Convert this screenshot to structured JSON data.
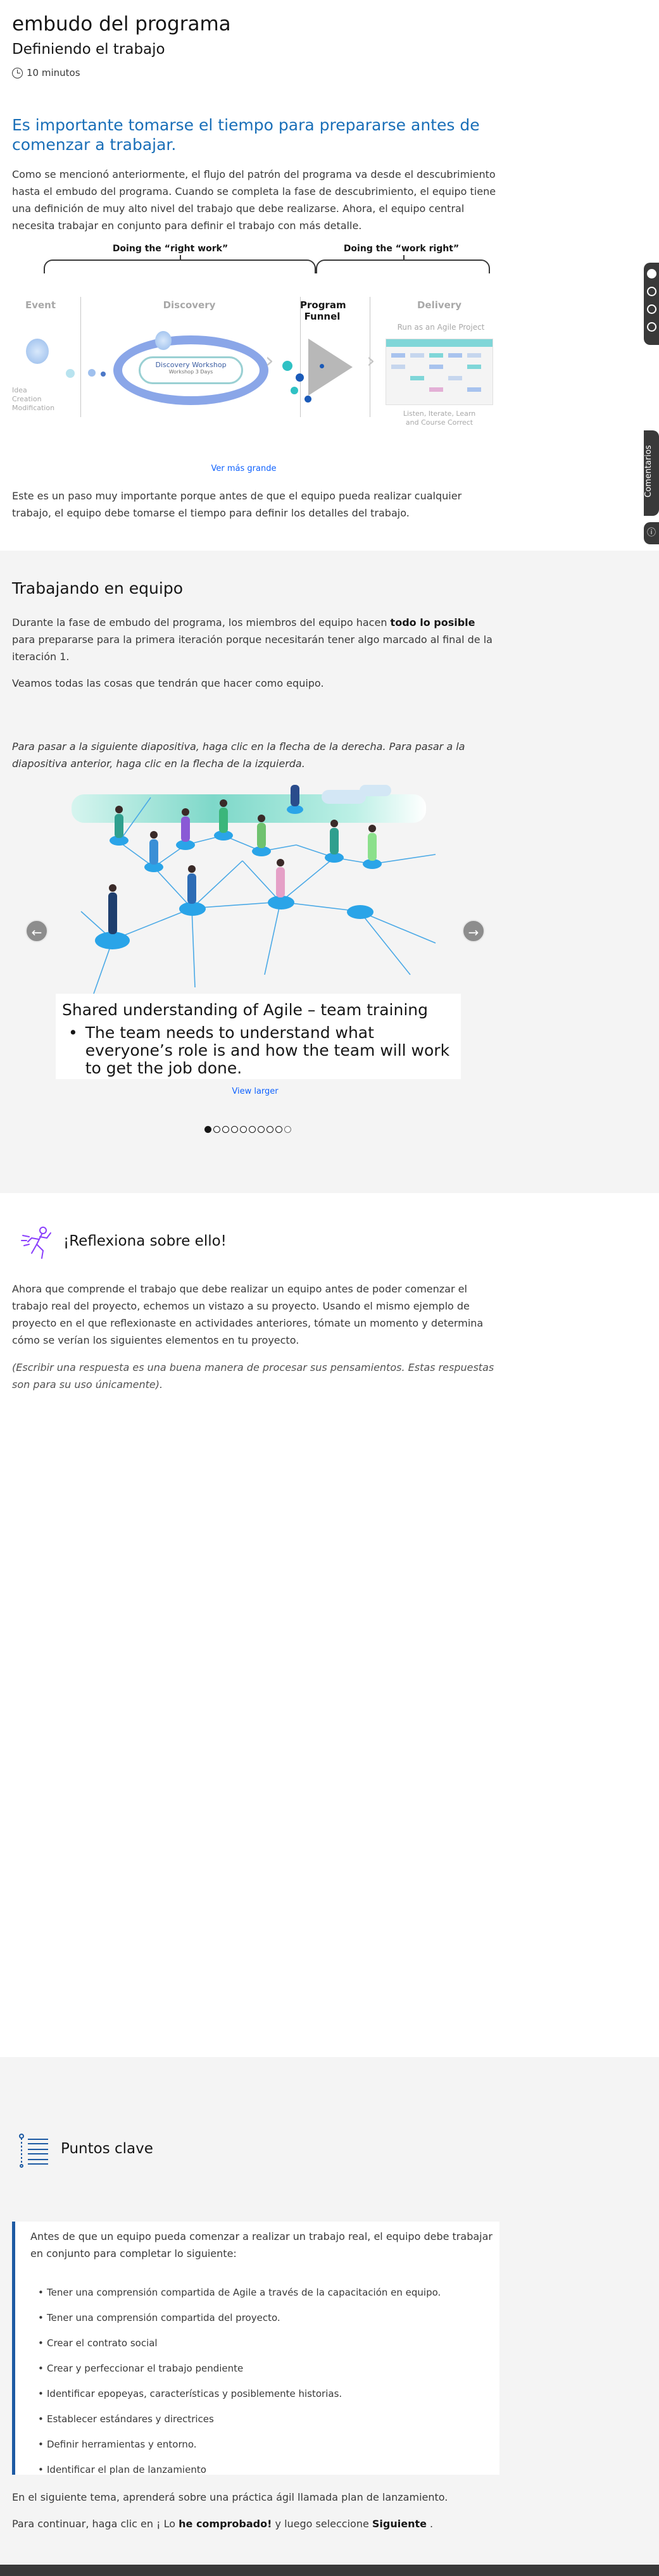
{
  "header": {
    "title": "embudo del programa",
    "subtitle": "Definiendo el trabajo",
    "duration": "10 minutos"
  },
  "section1": {
    "heading": "Es importante tomarse el tiempo para prepararse antes de comenzar a trabajar.",
    "p1": "Como se mencionó anteriormente, el flujo del patrón del programa va desde el descubrimiento hasta el embudo del programa. Cuando se completa la fase de descubrimiento, el equipo tiene una definición de muy alto nivel del trabajo que debe realizarse. Ahora, el equipo central necesita trabajar en conjunto para definir el trabajo con más detalle.",
    "view_larger": "Ver más grande",
    "p2": "Este es un paso muy importante porque antes de que el equipo pueda realizar cualquier trabajo, el equipo debe tomarse el tiempo para definir los detalles del trabajo."
  },
  "diagram": {
    "group_left": "Doing the “right work”",
    "group_right": "Doing the “work right”",
    "col_event": "Event",
    "col_discovery": "Discovery",
    "col_funnel": "Program Funnel",
    "col_delivery": "Delivery",
    "idea_text": "Idea\nCreation\nModification",
    "workshop_title": "Discovery Workshop",
    "workshop_sub": "Workshop 3 Days",
    "run_label": "Run as an Agile Project",
    "delivery_text": "Listen, Iterate, Learn\nand Course Correct"
  },
  "section2": {
    "heading": "Trabajando en equipo",
    "p1_before": "Durante la fase de embudo del programa, los miembros del equipo hacen ",
    "p1_bold": "todo lo posible",
    "p1_after": " para prepararse para la primera iteración porque necesitarán tener algo marcado al final de la iteración 1.",
    "p2": "Veamos todas las cosas que tendrán que hacer como equipo.",
    "instructions": "Para pasar a la siguiente diapositiva, haga clic en la flecha de la derecha. Para pasar a la diapositiva anterior, haga clic en la flecha de la izquierda."
  },
  "carousel": {
    "caption_title": "Shared understanding of Agile – team training",
    "caption_bullet": "The team needs to understand what everyone’s role is and how the team will work to get the job done.",
    "view_larger": "View larger",
    "slide_count": 10,
    "current_slide": 1
  },
  "section3": {
    "heading": "¡Reflexiona sobre ello!",
    "p1": "Ahora que comprende el trabajo que debe realizar un equipo antes de poder comenzar el trabajo real del proyecto, echemos un vistazo a su proyecto. Usando el mismo ejemplo de proyecto en el que reflexionaste en actividades anteriores, tómate un momento y determina cómo se verían los siguientes elementos en tu proyecto.",
    "p2": "(Escribir una respuesta es una buena manera de procesar sus pensamientos. Estas respuestas son para su uso únicamente)."
  },
  "section4": {
    "heading": "Puntos clave",
    "intro": "Antes de que un equipo pueda comenzar a realizar un trabajo real, el equipo debe trabajar en conjunto para completar lo siguiente:",
    "items": [
      "Tener una comprensión compartida de Agile a través de la capacitación en equipo.",
      "Tener una comprensión compartida del proyecto.",
      "Crear el contrato social",
      "Crear y perfeccionar el trabajo pendiente",
      "Identificar epopeyas, características y posiblemente historias.",
      "Establecer estándares y directrices",
      "Definir herramientas y entorno.",
      "Identificar el plan de lanzamiento"
    ],
    "next_topic": "En el siguiente tema, aprenderá sobre una práctica ágil llamada plan de lanzamiento.",
    "continue_before": "Para continuar, haga clic en ¡ Lo ",
    "continue_bold1": "he comprobado!",
    "continue_mid": " y luego seleccione ",
    "continue_bold2": "Siguiente",
    "continue_after": " ."
  },
  "side": {
    "comments_label": "Comentarios",
    "help_icon": "help-icon"
  },
  "colors": {
    "heading_blue": "#1a6fb8",
    "link_blue": "#0f62fe",
    "accent_dark_blue": "#1d5aa3",
    "section_gray": "#f4f4f4"
  }
}
